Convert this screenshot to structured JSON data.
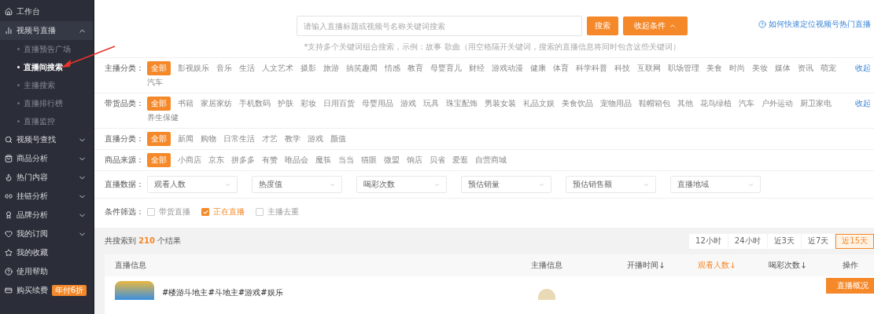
{
  "sidebar": {
    "items": [
      {
        "label": "工作台"
      },
      {
        "label": "视频号直播",
        "expanded": true,
        "children": [
          {
            "label": "直播预告广场",
            "selected": false
          },
          {
            "label": "直播间搜索",
            "selected": true
          },
          {
            "label": "主播搜索",
            "selected": false
          },
          {
            "label": "直播排行榜",
            "selected": false
          },
          {
            "label": "直播监控",
            "selected": false
          }
        ]
      },
      {
        "label": "视频号查找",
        "expanded": false
      },
      {
        "label": "商品分析",
        "expanded": false
      },
      {
        "label": "热门内容",
        "expanded": false
      },
      {
        "label": "挂链分析",
        "expanded": false
      },
      {
        "label": "品牌分析",
        "expanded": false
      },
      {
        "label": "我的订阅",
        "expanded": false
      },
      {
        "label": "我的收藏"
      },
      {
        "label": "使用帮助"
      },
      {
        "label": "购买续费",
        "badge": "年付6折"
      }
    ]
  },
  "search": {
    "placeholder": "请输入直播标题或视频号名称关键词搜索",
    "button": "搜索",
    "collapse_button": "收起条件",
    "hint": "*支持多个关键词组合搜索，示例：故事 歌曲（用空格隔开关键词，搜索的直播信息将同时包含这些关键词）"
  },
  "help_link": "如何快速定位视频号热门直播",
  "filters": [
    {
      "label": "主播分类：",
      "collapse": "收起",
      "options": [
        {
          "label": "全部",
          "selected": true
        },
        {
          "label": "影视娱乐",
          "selected": false
        },
        {
          "label": "音乐",
          "selected": false
        },
        {
          "label": "生活",
          "selected": false
        },
        {
          "label": "人文艺术",
          "selected": false
        },
        {
          "label": "摄影",
          "selected": false
        },
        {
          "label": "旅游",
          "selected": false
        },
        {
          "label": "搞笑趣闻",
          "selected": false
        },
        {
          "label": "情感",
          "selected": false
        },
        {
          "label": "教育",
          "selected": false
        },
        {
          "label": "母婴育儿",
          "selected": false
        },
        {
          "label": "财经",
          "selected": false
        },
        {
          "label": "游戏动漫",
          "selected": false
        },
        {
          "label": "健康",
          "selected": false
        },
        {
          "label": "体育",
          "selected": false
        },
        {
          "label": "科学科普",
          "selected": false
        },
        {
          "label": "科技",
          "selected": false
        },
        {
          "label": "互联网",
          "selected": false
        },
        {
          "label": "职场管理",
          "selected": false
        },
        {
          "label": "美食",
          "selected": false
        },
        {
          "label": "时尚",
          "selected": false
        },
        {
          "label": "美妆",
          "selected": false
        },
        {
          "label": "媒体",
          "selected": false
        },
        {
          "label": "资讯",
          "selected": false
        },
        {
          "label": "萌宠",
          "selected": false
        },
        {
          "label": "汽车",
          "selected": false
        }
      ]
    },
    {
      "label": "带货品类：",
      "collapse": "收起",
      "options": [
        {
          "label": "全部",
          "selected": true
        },
        {
          "label": "书籍",
          "selected": false
        },
        {
          "label": "家居家纺",
          "selected": false
        },
        {
          "label": "手机数码",
          "selected": false
        },
        {
          "label": "护肤",
          "selected": false
        },
        {
          "label": "彩妆",
          "selected": false
        },
        {
          "label": "日用百货",
          "selected": false
        },
        {
          "label": "母婴用品",
          "selected": false
        },
        {
          "label": "游戏",
          "selected": false
        },
        {
          "label": "玩具",
          "selected": false
        },
        {
          "label": "珠宝配饰",
          "selected": false
        },
        {
          "label": "男装女装",
          "selected": false
        },
        {
          "label": "礼品文娱",
          "selected": false
        },
        {
          "label": "美食饮品",
          "selected": false
        },
        {
          "label": "宠物用品",
          "selected": false
        },
        {
          "label": "鞋帽箱包",
          "selected": false
        },
        {
          "label": "其他",
          "selected": false
        },
        {
          "label": "花鸟绿植",
          "selected": false
        },
        {
          "label": "汽车",
          "selected": false
        },
        {
          "label": "户外运动",
          "selected": false
        },
        {
          "label": "厨卫家电",
          "selected": false
        },
        {
          "label": "养生保健",
          "selected": false
        }
      ]
    },
    {
      "label": "直播分类：",
      "options": [
        {
          "label": "全部",
          "selected": true
        },
        {
          "label": "新闻",
          "selected": false
        },
        {
          "label": "购物",
          "selected": false
        },
        {
          "label": "日常生活",
          "selected": false
        },
        {
          "label": "才艺",
          "selected": false
        },
        {
          "label": "教学",
          "selected": false
        },
        {
          "label": "游戏",
          "selected": false
        },
        {
          "label": "颜值",
          "selected": false
        }
      ]
    },
    {
      "label": "商品来源：",
      "options": [
        {
          "label": "全部",
          "selected": true
        },
        {
          "label": "小商店",
          "selected": false
        },
        {
          "label": "京东",
          "selected": false
        },
        {
          "label": "拼多多",
          "selected": false
        },
        {
          "label": "有赞",
          "selected": false
        },
        {
          "label": "唯品会",
          "selected": false
        },
        {
          "label": "魔筷",
          "selected": false
        },
        {
          "label": "当当",
          "selected": false
        },
        {
          "label": "猫眼",
          "selected": false
        },
        {
          "label": "微盟",
          "selected": false
        },
        {
          "label": "饷店",
          "selected": false
        },
        {
          "label": "贝省",
          "selected": false
        },
        {
          "label": "爱逛",
          "selected": false
        },
        {
          "label": "自营商城",
          "selected": false
        }
      ]
    }
  ],
  "data_filter": {
    "label": "直播数据：",
    "selects": [
      "观看人数",
      "热度值",
      "喝彩次数",
      "预估销量",
      "预估销售额",
      "直播地域"
    ]
  },
  "conditions": {
    "label": "条件筛选：",
    "items": [
      {
        "label": "带货直播",
        "checked": false
      },
      {
        "label": "正在直播",
        "checked": true
      },
      {
        "label": "主播去重",
        "checked": false
      }
    ]
  },
  "results": {
    "prefix": "共搜索到",
    "count": "210",
    "suffix": "个结果"
  },
  "time_tabs": [
    {
      "label": "12小时",
      "selected": false
    },
    {
      "label": "24小时",
      "selected": false
    },
    {
      "label": "近3天",
      "selected": false
    },
    {
      "label": "近7天",
      "selected": false
    },
    {
      "label": "近15天",
      "selected": true
    }
  ],
  "table": {
    "columns": [
      {
        "label": "直播信息",
        "sortable": false,
        "selected": false
      },
      {
        "label": "主播信息",
        "sortable": false,
        "selected": false
      },
      {
        "label": "开播时间",
        "sortable": true,
        "selected": false
      },
      {
        "label": "观看人数",
        "sortable": true,
        "selected": true
      },
      {
        "label": "喝彩次数",
        "sortable": true,
        "selected": false
      },
      {
        "label": "操作",
        "sortable": false,
        "selected": false
      }
    ],
    "rows": [
      {
        "title": "#楼游斗地主#斗地主#游戏#娱乐",
        "action": "直播概况"
      }
    ]
  }
}
